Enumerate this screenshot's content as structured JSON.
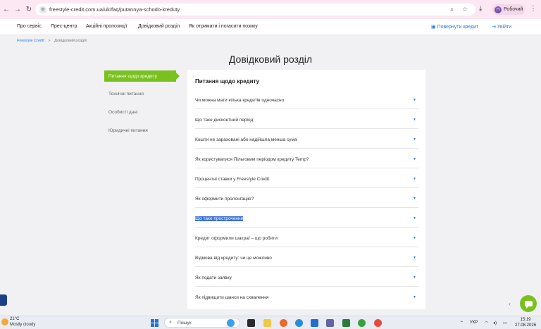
{
  "browser": {
    "url": "freestyle-credit.com.ua/uk/faq/putannya-schodo-kreduty",
    "profile_initial": "Н",
    "profile_name": "Робочий"
  },
  "header": {
    "nav": [
      "Про сервіс",
      "Прес-центр",
      "Акційні пропозиції",
      "Довідковий розділ",
      "Як отримати і погасити позику"
    ],
    "return_credit": "Повернути кредит",
    "login": "Увійти"
  },
  "breadcrumb": {
    "home": "Freestyle Credit",
    "separator": ">",
    "current": "Довідковий розділ"
  },
  "page_title": "Довідковий розділ",
  "sidebar": {
    "active": "Питання щодо кредиту",
    "items": [
      "Технічні питання",
      "Особисті дані",
      "Юридичні питання"
    ]
  },
  "faq": {
    "heading": "Питання щодо кредиту",
    "questions": [
      "Чи можна мати кілька кредитів одночасно",
      "Що таке дисконтний період",
      "Кошти не зараховані або надійшла менша сума",
      "Як користуватися Пільговим періодом кредиту Temp?",
      "Процентні ставки у Freestyle Credit",
      "Як оформити пролонгацію?",
      "Що таке прострочення",
      "Кредит оформили шахраї – що робити",
      "Відмова від кредиту: чи це можливо",
      "Як подати заявку",
      "Як підвищити шанси на схвалення"
    ],
    "selected_index": 6
  },
  "taskbar": {
    "temperature": "21°C",
    "weather": "Mostly cloudy",
    "search_placeholder": "Пошук",
    "language": "УКР",
    "time": "15:19",
    "date": "27.08.2026"
  },
  "colors": {
    "accent_green": "#7ac120",
    "link_blue": "#2d7bd4",
    "chrome_pink": "#fbe8f3"
  }
}
